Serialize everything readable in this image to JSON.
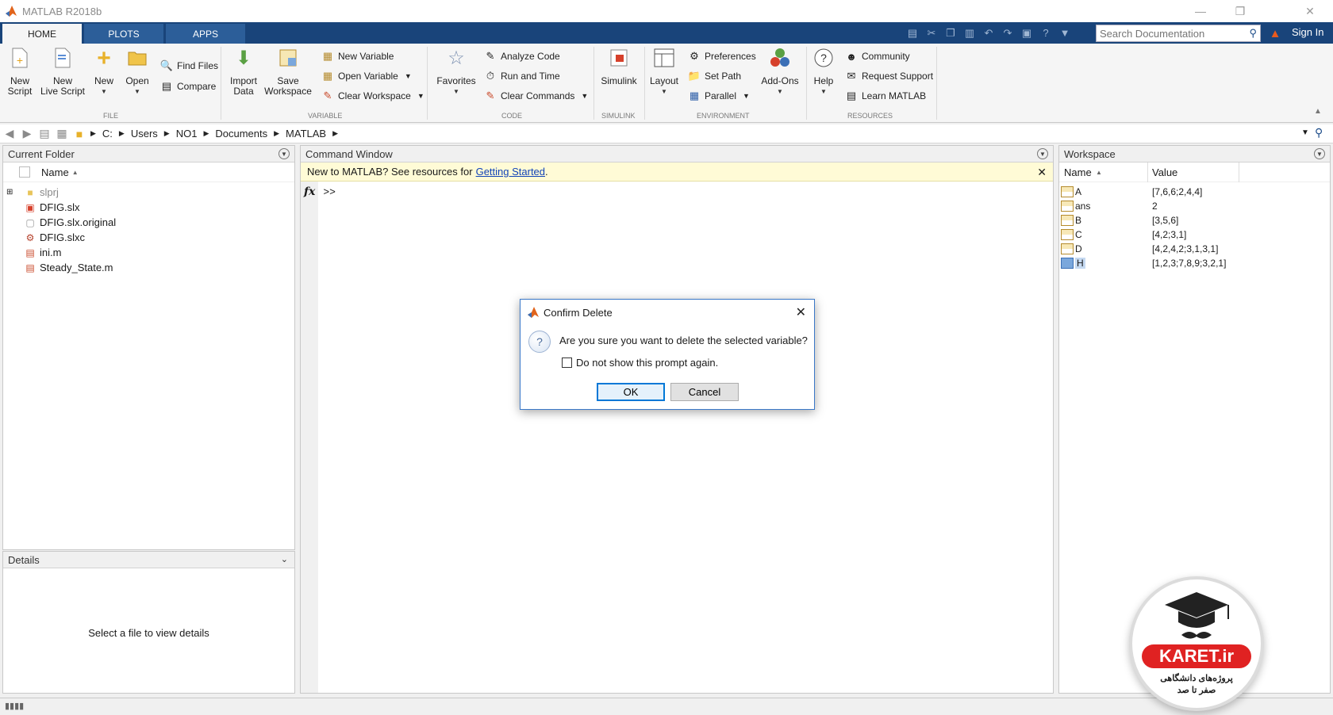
{
  "window": {
    "title": "MATLAB R2018b"
  },
  "ribbon_tabs": [
    {
      "label": "HOME",
      "active": true
    },
    {
      "label": "PLOTS",
      "active": false
    },
    {
      "label": "APPS",
      "active": false
    }
  ],
  "search": {
    "placeholder": "Search Documentation"
  },
  "signin_label": "Sign In",
  "file_group": {
    "new_script": [
      "New",
      "Script"
    ],
    "new_live_script": [
      "New",
      "Live Script"
    ],
    "new": "New",
    "open": "Open",
    "find_files": "Find Files",
    "compare": "Compare",
    "label": "FILE"
  },
  "variable_group": {
    "import_data": [
      "Import",
      "Data"
    ],
    "save_workspace": [
      "Save",
      "Workspace"
    ],
    "new_variable": "New Variable",
    "open_variable": "Open Variable",
    "clear_workspace": "Clear Workspace",
    "label": "VARIABLE"
  },
  "code_group": {
    "favorites": "Favorites",
    "analyze_code": "Analyze Code",
    "run_and_time": "Run and Time",
    "clear_commands": "Clear Commands",
    "label": "CODE"
  },
  "simulink_group": {
    "simulink": "Simulink",
    "label": "SIMULINK"
  },
  "environment_group": {
    "layout": "Layout",
    "preferences": "Preferences",
    "set_path": "Set Path",
    "parallel": "Parallel",
    "add_ons": "Add-Ons",
    "label": "ENVIRONMENT"
  },
  "resources_group": {
    "help": "Help",
    "community": "Community",
    "request_support": "Request Support",
    "learn_matlab": "Learn MATLAB",
    "label": "RESOURCES"
  },
  "breadcrumbs": [
    "C:",
    "Users",
    "NO1",
    "Documents",
    "MATLAB"
  ],
  "current_folder": {
    "title": "Current Folder",
    "column_name": "Name",
    "files": [
      {
        "name": "slprj",
        "icon": "folder-icon"
      },
      {
        "name": "DFIG.slx",
        "icon": "simulink-model-icon"
      },
      {
        "name": "DFIG.slx.original",
        "icon": "file-icon"
      },
      {
        "name": "DFIG.slxc",
        "icon": "slxc-file-icon"
      },
      {
        "name": "ini.m",
        "icon": "m-file-icon"
      },
      {
        "name": "Steady_State.m",
        "icon": "m-file-icon"
      }
    ]
  },
  "details": {
    "title": "Details",
    "placeholder": "Select a file to view details"
  },
  "command_window": {
    "title": "Command Window",
    "banner_text": "New to MATLAB? See resources for",
    "banner_link": "Getting Started",
    "banner_period": ".",
    "fx": "fx",
    "prompt": ">>"
  },
  "workspace": {
    "title": "Workspace",
    "col_name": "Name",
    "col_value": "Value",
    "variables": [
      {
        "name": "A",
        "value": "[7,6,6;2,4,4]"
      },
      {
        "name": "ans",
        "value": "2"
      },
      {
        "name": "B",
        "value": "[3,5,6]"
      },
      {
        "name": "C",
        "value": "[4,2;3,1]"
      },
      {
        "name": "D",
        "value": "[4,2,4,2;3,1,3,1]"
      },
      {
        "name": "H",
        "value": "[1,2,3;7,8,9;3,2,1]"
      }
    ]
  },
  "dialog": {
    "title": "Confirm Delete",
    "message": "Are you sure you want to delete the selected variable?",
    "checkbox_label": "Do not show this prompt again.",
    "ok_label": "OK",
    "cancel_label": "Cancel"
  },
  "watermark": {
    "brand": "KARET.ir",
    "tagline_line1": "پروژه‌های دانشگاهی",
    "tagline_line2": "صفر تا صد"
  },
  "colors": {
    "tab_bar": "#19447a",
    "accent": "#0078d7",
    "banner": "#fffbd6",
    "link": "#1143b8",
    "watermark_red": "#e02222"
  }
}
